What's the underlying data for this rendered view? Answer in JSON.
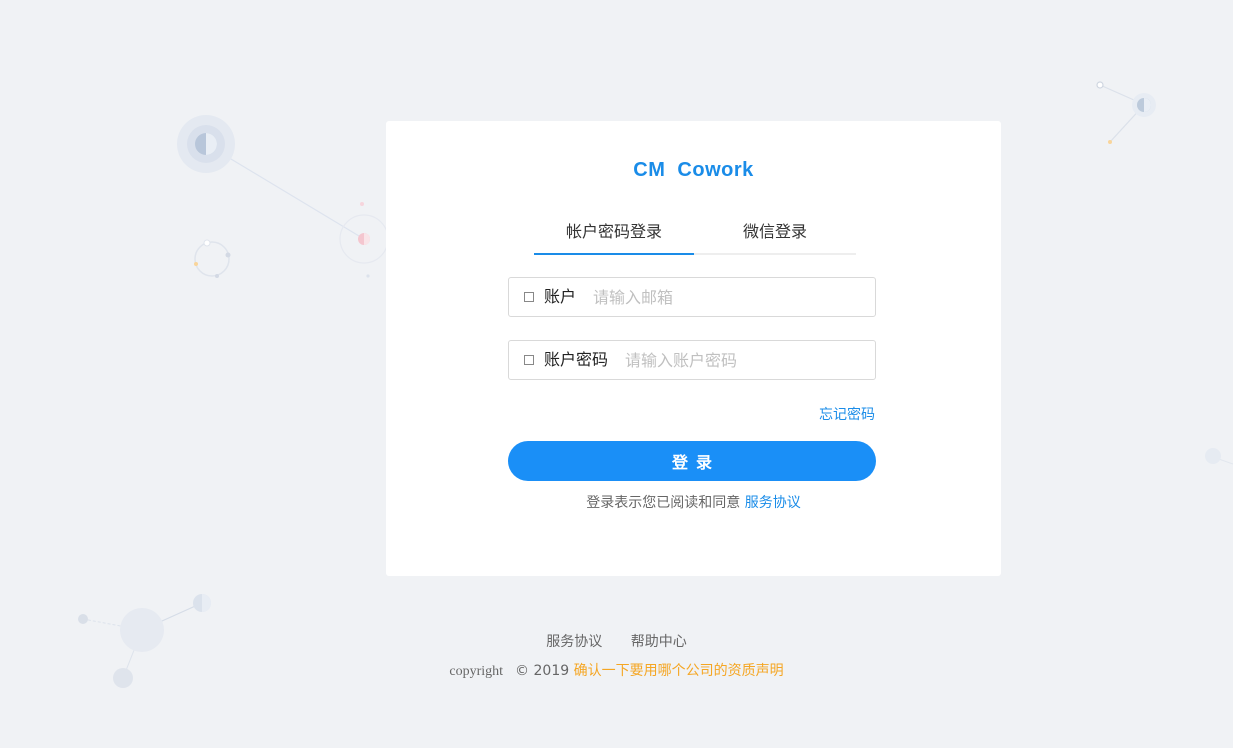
{
  "brand": {
    "logo_text": "CM  Cowork"
  },
  "tabs": {
    "account_login": "帐户密码登录",
    "wechat_login": "微信登录"
  },
  "form": {
    "email_label": "账户",
    "email_placeholder": "请输入邮箱",
    "password_label": "账户密码",
    "password_placeholder": "请输入账户密码",
    "forgot_password": "忘记密码",
    "login_button": "登录"
  },
  "agreement": {
    "prefix": "登录表示您已阅读和同意",
    "link": "服务协议"
  },
  "footer": {
    "links": [
      "服务协议",
      "帮助中心"
    ],
    "copyright_word": "copyright",
    "copyright_symbol": "©",
    "year": "2019",
    "company": "确认一下要用哪个公司的资质声明"
  },
  "colors": {
    "accent": "#1a8ce8",
    "button": "#1a8ff7",
    "background": "#f0f2f5",
    "company_text": "#f5a623"
  },
  "icons": {
    "field_icon": "square-outline-icon"
  }
}
